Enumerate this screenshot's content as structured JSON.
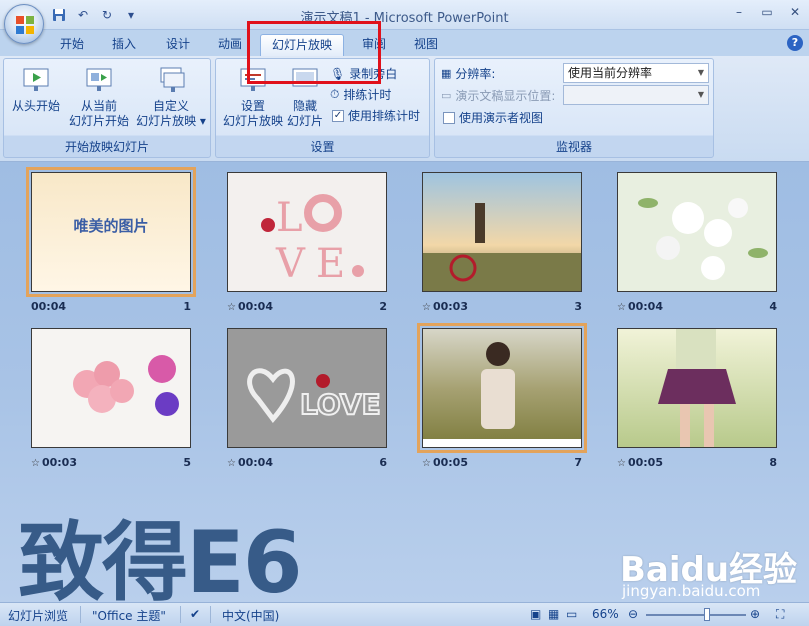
{
  "titlebar": {
    "title": "演示文稿1 - Microsoft PowerPoint",
    "qat": {
      "save": "save-icon",
      "undo": "undo-icon",
      "redo": "redo-icon",
      "customize": "▾"
    }
  },
  "tabs": [
    "开始",
    "插入",
    "设计",
    "动画",
    "幻灯片放映",
    "审阅",
    "视图"
  ],
  "active_tab": "幻灯片放映",
  "ribbon": {
    "groups": {
      "start": {
        "label": "开始放映幻灯片",
        "from_beginning": "从头开始",
        "from_current_1": "从当前",
        "from_current_2": "幻灯片开始",
        "custom_1": "自定义",
        "custom_2": "幻灯片放映 ▾"
      },
      "setup": {
        "label": "设置",
        "setup_1": "设置",
        "setup_2": "幻灯片放映",
        "hide_1": "隐藏",
        "hide_2": "幻灯片",
        "record": "录制旁白",
        "rehearse": "排练计时",
        "use_timings": "使用排练计时"
      },
      "monitors": {
        "label": "监视器",
        "resolution_label": "分辨率:",
        "resolution_value": "使用当前分辨率",
        "show_on_label": "演示文稿显示位置:",
        "show_on_value": "",
        "presenter_view": "使用演示者视图"
      }
    }
  },
  "slides": [
    {
      "num": "1",
      "time": "00:04",
      "title": "唯美的图片"
    },
    {
      "num": "2",
      "time": "00:04"
    },
    {
      "num": "3",
      "time": "00:03"
    },
    {
      "num": "4",
      "time": "00:04"
    },
    {
      "num": "5",
      "time": "00:03"
    },
    {
      "num": "6",
      "time": "00:04"
    },
    {
      "num": "7",
      "time": "00:05"
    },
    {
      "num": "8",
      "time": "00:05"
    }
  ],
  "watermark": {
    "text": "致得E6",
    "baidu": "Baidu经验",
    "baidu_url": "jingyan.baidu.com"
  },
  "statusbar": {
    "view": "幻灯片浏览",
    "theme": "\"Office 主题\"",
    "language": "中文(中国)",
    "zoom": "66%"
  }
}
